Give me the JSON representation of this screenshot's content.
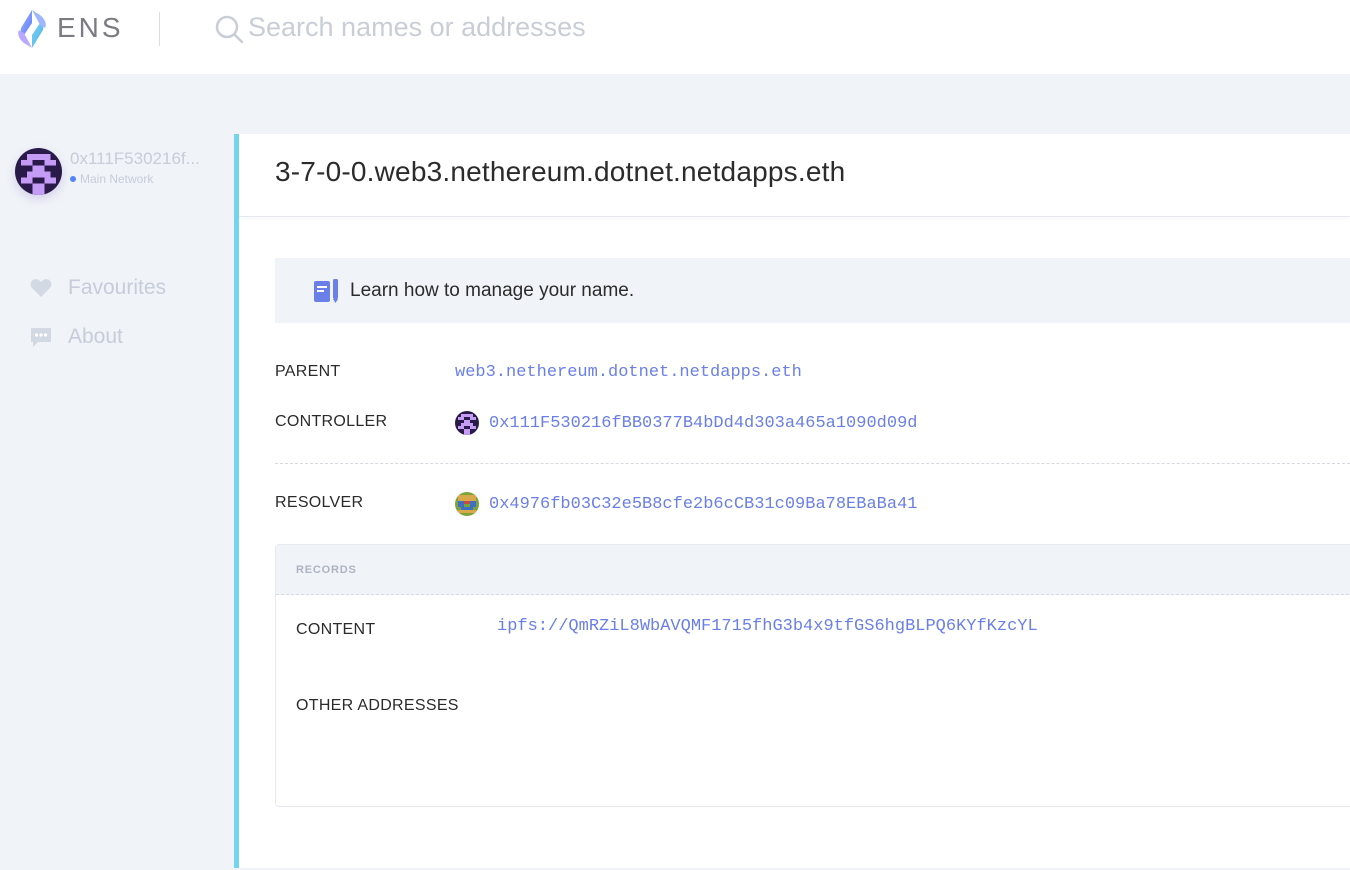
{
  "header": {
    "logo_text": "ENS",
    "search": {
      "placeholder": "Search names or addresses",
      "value": ""
    }
  },
  "sidebar": {
    "account": {
      "address": "0x111F530216fBB0377B4bDd4d303a465a1090d09d",
      "address_display": "0x111F530216f...",
      "network": "Main Network"
    },
    "items": [
      {
        "label": "Favourites",
        "icon": "heart-icon"
      },
      {
        "label": "About",
        "icon": "chat-bubble-icon"
      }
    ]
  },
  "main": {
    "domain": "3-7-0-0.web3.nethereum.dotnet.netdapps.eth",
    "learn_banner": "Learn how to manage your name.",
    "details": {
      "parent_label": "PARENT",
      "parent_value": "web3.nethereum.dotnet.netdapps.eth",
      "controller_label": "CONTROLLER",
      "controller_value": "0x111F530216fBB0377B4bDd4d303a465a1090d09d",
      "resolver_label": "RESOLVER",
      "resolver_value": "0x4976fb03C32e5B8cfe2b6cCB31c09Ba78EBaBa41"
    },
    "records": {
      "title": "RECORDS",
      "content_label": "CONTENT",
      "content_value": "ipfs://QmRZiL8WbAVQMF1715fhG3b4x9tfGS6hgBLPQ6KYfKzcYL",
      "other_addresses_label": "OTHER ADDRESSES"
    }
  },
  "colors": {
    "accent": "#6a7fe8",
    "card_border": "#72d7ee",
    "background": "#f0f4f8",
    "muted_text": "#c6ccd8"
  }
}
